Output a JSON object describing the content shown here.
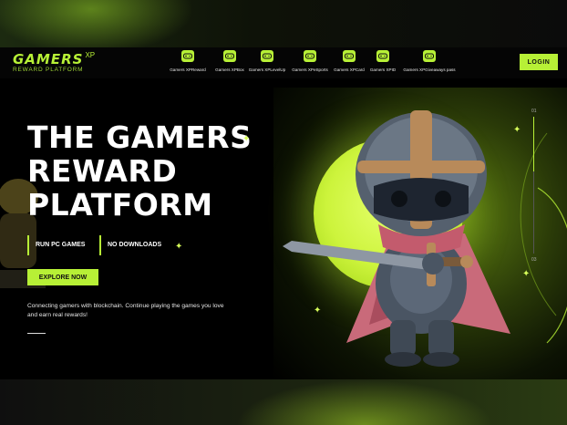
{
  "brand": {
    "name": "GAMERS",
    "suffix": "XP",
    "tagline": "REWARD PLATFORM"
  },
  "nav": {
    "items": [
      {
        "label": "Gamers XPReward",
        "icon": "gamepad-icon"
      },
      {
        "label": "Gamers XPBox",
        "icon": "gamepad-icon"
      },
      {
        "label": "Gamers XPLevelUp",
        "icon": "gamepad-icon"
      },
      {
        "label": "Gamers XPeSports",
        "icon": "gamepad-icon"
      },
      {
        "label": "Gamers XPCard",
        "icon": "gamepad-icon"
      },
      {
        "label": "Gamers XPID",
        "icon": "gamepad-icon"
      },
      {
        "label": "Gamers XPGiveaways pass",
        "icon": "gamepad-icon"
      }
    ],
    "login_label": "LOGIN"
  },
  "hero": {
    "title_lines": [
      "THE GAMERS",
      "REWARD",
      "PLATFORM"
    ],
    "badges": [
      "RUN PC GAMES",
      "NO DOWNLOADS"
    ],
    "cta_label": "EXPLORE NOW",
    "description": "Connecting gamers with blockchain. Continue playing the games you love and earn real rewards!",
    "slider": {
      "top_label": "01",
      "bottom_label": "03"
    }
  },
  "colors": {
    "accent": "#b7f036",
    "background": "#000000"
  }
}
